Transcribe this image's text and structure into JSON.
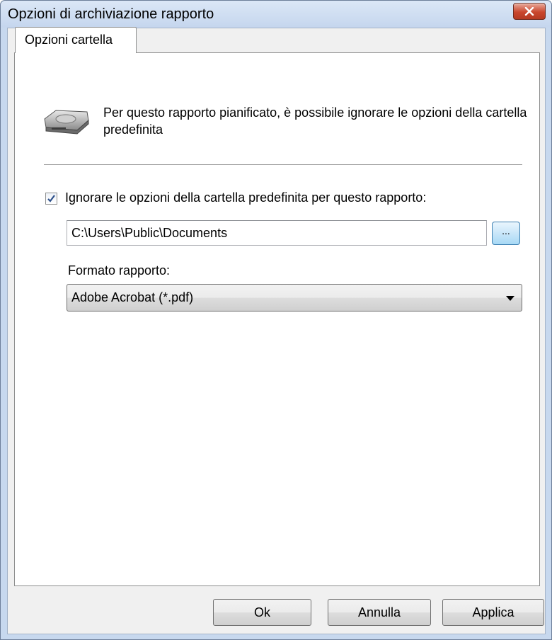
{
  "window": {
    "title": "Opzioni di archiviazione rapporto",
    "close_icon": "close-icon",
    "accent_color": "#c7d8ee",
    "close_color": "#c9472e"
  },
  "tabs": [
    {
      "label": "Opzioni cartella",
      "selected": true
    }
  ],
  "panel": {
    "drive_icon": "drive-icon",
    "description": "Per questo rapporto pianificato, è possibile ignorare le opzioni della cartella predefinita",
    "override_checkbox": {
      "label": "Ignorare le opzioni della cartella predefinita per questo rapporto:",
      "checked": true
    },
    "path_value": "C:\\Users\\Public\\Documents",
    "browse_label": "...",
    "format_label": "Formato rapporto:",
    "format_selected": "Adobe Acrobat (*.pdf)"
  },
  "buttons": {
    "ok": "Ok",
    "cancel": "Annulla",
    "apply": "Applica"
  }
}
